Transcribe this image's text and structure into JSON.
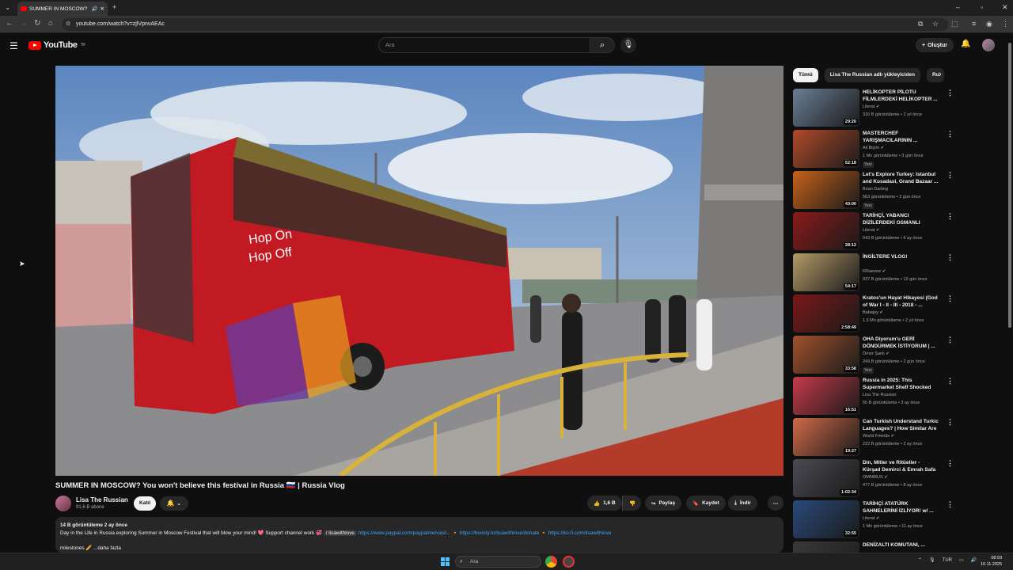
{
  "browser": {
    "tab_title": "SUMMER IN MOSCOW? Yo",
    "url": "youtube.com/watch?v=zjlVpnvAEAc"
  },
  "header": {
    "logo_text": "YouTube",
    "logo_region": "TR",
    "search_placeholder": "Ara",
    "create_label": "Oluştur"
  },
  "video": {
    "title": "SUMMER IN MOSCOW? You won't believe this festival in Russia 🇷🇺 | Russia Vlog",
    "channel_name": "Lisa The Russian",
    "channel_subs": "91,6 B abone",
    "join_label": "Katıl",
    "likes": "1,6 B",
    "share_label": "Paylaş",
    "save_label": "Kaydet",
    "download_label": "İndir",
    "bus_text_1": "Hop On",
    "bus_text_2": "Hop Off"
  },
  "description": {
    "stats": "14 B görüntüleme  2 ay önce",
    "text": "Day in the Life in Russia exploring Summer in Moscow Festival that will blow your mind! 💖 Support channel work 💞",
    "handle": "/ lisawithlove",
    "link1": "https://www.paypal.com/paypalme/vasil...",
    "link2": "https://boosty.to/lisawithlove/donate",
    "link3": "https://ko-fi.com/lisawithlove",
    "line2": "milestones 🥖  ...daha fazla"
  },
  "chips": [
    "Tümü",
    "Lisa The Russian adlı yükleyiciden",
    "Ru"
  ],
  "recommendations": [
    {
      "title": "HELİKOPTER PİLOTU FİLMLERDEKİ HELİKOPTER ...",
      "channel": "Literat ✔",
      "meta": "316 B görüntüleme • 2 yıl önce",
      "duration": "29:20",
      "badge": "",
      "color": "#6a7f94"
    },
    {
      "title": "MASTERCHEF YARIŞMACILARININ ...",
      "channel": "Ali Biçim ✔",
      "meta": "1 Mn görüntüleme • 3 gün önce",
      "duration": "52:18",
      "badge": "Yeni",
      "color": "#b14a2a"
    },
    {
      "title": "Let's Explore Turkey: Istanbul and Kusadasi, Grand Bazaar ...",
      "channel": "Brian Darling",
      "meta": "563 görüntüleme • 2 gün önce",
      "duration": "43:00",
      "badge": "Yeni",
      "color": "#c7621a"
    },
    {
      "title": "TARİHÇİ, YABANCI DİZİLERDEKİ OSMANLI SAHNELERİNİ ...",
      "channel": "Literat ✔",
      "meta": "543 B görüntüleme • 6 ay önce",
      "duration": "28:12",
      "badge": "",
      "color": "#8a1a1a"
    },
    {
      "title": "İNGİLTERE VLOG!",
      "channel": "RRaenee ✔",
      "meta": "937 B görüntüleme • 12 gün önce",
      "duration": "54:17",
      "badge": "",
      "color": "#b49a6a"
    },
    {
      "title": "Kratos'un Hayat Hikayesi (God of War I - II - III - 2018 - ...",
      "channel": "Babajoy ✔",
      "meta": "1,5 Mn görüntüleme • 2 yıl önce",
      "duration": "2:58:49",
      "badge": "",
      "color": "#7a1818"
    },
    {
      "title": "OHA Diyorum'u GERİ DÖNDÜRMEK İSTİYORUM | ...",
      "channel": "Ömer Şanlı ✔",
      "meta": "249 B görüntüleme • 2 gün önce",
      "duration": "33:58",
      "badge": "Yeni",
      "color": "#a0522d"
    },
    {
      "title": "Russia in 2025: This Supermarket Shelf Shocked M...",
      "channel": "Lisa The Russian",
      "meta": "55 B görüntüleme • 3 ay önce",
      "duration": "16:51",
      "badge": "",
      "color": "#c73a4a"
    },
    {
      "title": "Can Turkish Understand Turkic Languages? | How Similar Are ...",
      "channel": "World Friends ✔",
      "meta": "222 B görüntüleme • 2 ay önce",
      "duration": "19:27",
      "badge": "",
      "color": "#d06a4a"
    },
    {
      "title": "Din, Mitler ve Ritüeller - Kürşad Demirci & Emrah Safa Gürkan ...",
      "channel": "OMNIBUS ✔",
      "meta": "477 B görüntüleme • 8 ay önce",
      "duration": "1:02:34",
      "badge": "",
      "color": "#4a4a52"
    },
    {
      "title": "TARİHÇİ ATATÜRK SAHNELERİNİ İZLİYOR! w/ ...",
      "channel": "Literat ✔",
      "meta": "1 Mn görüntüleme • 11 ay önce",
      "duration": "32:55",
      "badge": "",
      "color": "#2a4a7a"
    },
    {
      "title": "DENİZALTI KOMUTANI, ...",
      "channel": "",
      "meta": "",
      "duration": "",
      "badge": "",
      "color": "#3a3a3a"
    }
  ],
  "taskbar": {
    "search_placeholder": "Ara",
    "lang": "TUR",
    "time": "08:59",
    "date": "10.11.2025"
  }
}
